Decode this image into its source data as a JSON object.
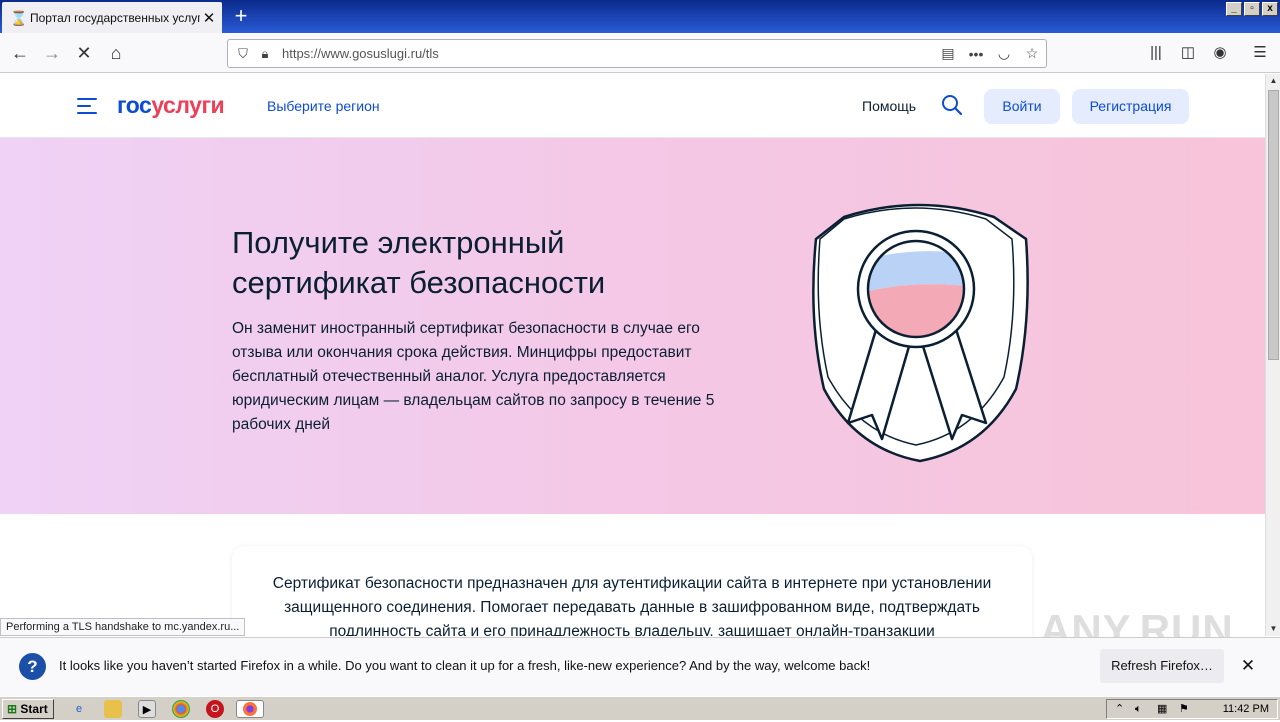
{
  "browser": {
    "tab_title": "Портал государственных услуг",
    "url": "https://www.gosuslugi.ru/tls",
    "status_text": "Performing a TLS handshake to mc.yandex.ru...",
    "notification": {
      "text": "It looks like you haven’t started Firefox in a while. Do you want to clean it up for a fresh, like-new experience? And by the way, welcome back!",
      "button_label": "Refresh Firefox…",
      "close_glyph": "✕"
    }
  },
  "site": {
    "logo_part1": "гос",
    "logo_part2": "услуги",
    "region_link": "Выберите регион",
    "help_link": "Помощь",
    "login_button": "Войти",
    "register_button": "Регистрация",
    "brand_blue": "#0d4cd3",
    "brand_red": "#ee3f58"
  },
  "hero": {
    "title": "Получите электронный сертификат безопасности",
    "text": "Он заменит иностранный сертификат безопасности в случае его отзыва или окончания срока действия. Минцифры предоставит бесплатный отечественный аналог. Услуга предоставляется юридическим лицам — владельцам сайтов по запросу в течение 5 рабочих дней"
  },
  "card": {
    "text": "Сертификат безопасности предназначен для аутентификации сайта в интернете при установлении защищенного соединения. Помогает передавать данные в зашифрованном виде, подтверждать подлинность сайта и его принадлежность владельцу, защищает онлайн-транзакции"
  },
  "overlay": {
    "watermark": "ANY.RUN"
  },
  "taskbar": {
    "start_label": "Start",
    "clock": "11:42 PM"
  }
}
